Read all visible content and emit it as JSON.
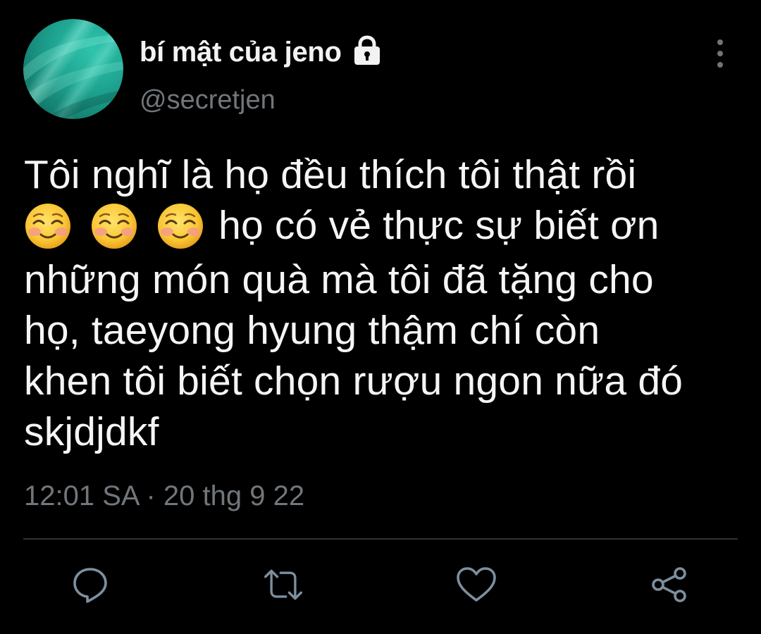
{
  "tweet": {
    "display_name": "bí mật của jeno",
    "handle": "@secretjen",
    "text_line1": "Tôi nghĩ là họ đều thích tôi thật rồi",
    "emojis": [
      "☺️",
      "☺️",
      "☺️"
    ],
    "text_line2_after_emoji": "họ có vẻ thực sự biết ơn",
    "text_line3": "những món quà mà tôi đã tặng cho",
    "text_line4": "họ, taeyong hyung thậm chí còn",
    "text_line5": "khen tôi biết chọn rượu ngon nữa đó",
    "text_line6": "skjdjdkf",
    "timestamp": "12:01 SA · 20 thg 9 22"
  },
  "icons": {
    "lock": "lock-icon",
    "more": "more-vertical-icon",
    "reply": "comment-icon",
    "retweet": "retweet-icon",
    "like": "heart-icon",
    "share": "share-icon"
  },
  "colors": {
    "background": "#000000",
    "text": "#e7e9ea",
    "muted": "#71767b",
    "divider": "#2f3336",
    "avatar": "#1fa592"
  }
}
